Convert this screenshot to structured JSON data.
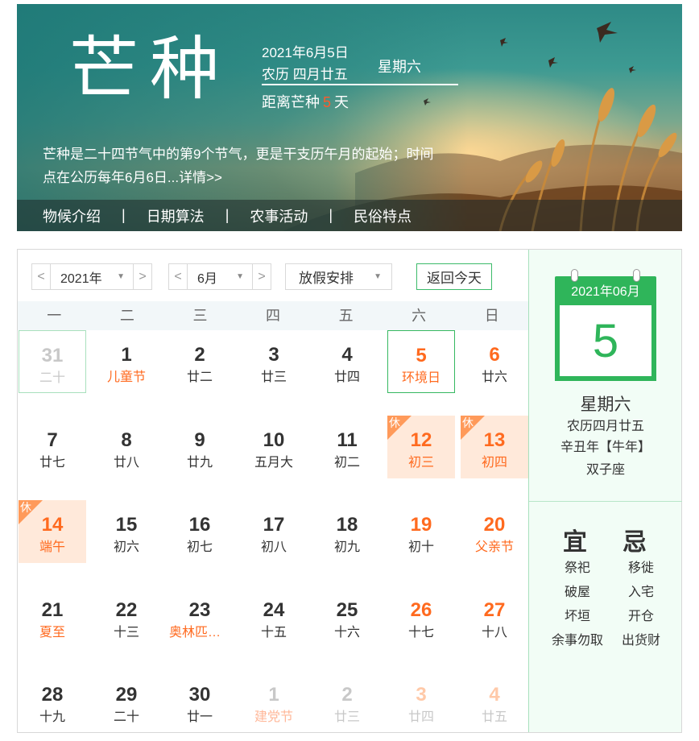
{
  "banner": {
    "term_name": "芒种",
    "date": "2021年6月5日",
    "lunar": "农历 四月廿五",
    "weekday": "星期六",
    "countdown_prefix": "距离芒种",
    "countdown_days": "5",
    "countdown_suffix": "天",
    "description": "芒种是二十四节气中的第9个节气，更是干支历午月的起始；时间点在公历每年6月6日...",
    "more_link": "详情>>",
    "nav": [
      "物候介绍",
      "日期算法",
      "农事活动",
      "民俗特点"
    ],
    "nav_separator": "|"
  },
  "toolbar": {
    "prev_arrow": "<",
    "next_arrow": ">",
    "year": "2021年",
    "month": "6月",
    "holiday": "放假安排",
    "today_button": "返回今天",
    "caret": "▼"
  },
  "weekdays": [
    "一",
    "二",
    "三",
    "四",
    "五",
    "六",
    "日"
  ],
  "rest_badge": "休",
  "days": [
    {
      "n": "31",
      "s": "二十",
      "other": true,
      "box": "first"
    },
    {
      "n": "1",
      "s": "儿童节",
      "fest": true
    },
    {
      "n": "2",
      "s": "廿二"
    },
    {
      "n": "3",
      "s": "廿三"
    },
    {
      "n": "4",
      "s": "廿四"
    },
    {
      "n": "5",
      "s": "环境日",
      "weekend": true,
      "box": "today"
    },
    {
      "n": "6",
      "s": "廿六",
      "weekend": true,
      "sub_plain": true
    },
    {
      "n": "7",
      "s": "廿七"
    },
    {
      "n": "8",
      "s": "廿八"
    },
    {
      "n": "9",
      "s": "廿九"
    },
    {
      "n": "10",
      "s": "五月大"
    },
    {
      "n": "11",
      "s": "初二"
    },
    {
      "n": "12",
      "s": "初三",
      "rest": true
    },
    {
      "n": "13",
      "s": "初四",
      "rest": true
    },
    {
      "n": "14",
      "s": "端午",
      "rest": true
    },
    {
      "n": "15",
      "s": "初六"
    },
    {
      "n": "16",
      "s": "初七"
    },
    {
      "n": "17",
      "s": "初八"
    },
    {
      "n": "18",
      "s": "初九"
    },
    {
      "n": "19",
      "s": "初十",
      "weekend": true,
      "sub_plain": true
    },
    {
      "n": "20",
      "s": "父亲节",
      "weekend": true
    },
    {
      "n": "21",
      "s": "夏至",
      "fest": true
    },
    {
      "n": "22",
      "s": "十三"
    },
    {
      "n": "23",
      "s": "奥林匹克日",
      "fest": true
    },
    {
      "n": "24",
      "s": "十五"
    },
    {
      "n": "25",
      "s": "十六"
    },
    {
      "n": "26",
      "s": "十七",
      "weekend": true,
      "sub_plain": true
    },
    {
      "n": "27",
      "s": "十八",
      "weekend": true,
      "sub_plain": true
    },
    {
      "n": "28",
      "s": "十九"
    },
    {
      "n": "29",
      "s": "二十"
    },
    {
      "n": "30",
      "s": "廿一"
    },
    {
      "n": "1",
      "s": "建党节",
      "other": true,
      "fest": true
    },
    {
      "n": "2",
      "s": "廿三",
      "other": true
    },
    {
      "n": "3",
      "s": "廿四",
      "other": true,
      "weekend": true,
      "sub_plain": true
    },
    {
      "n": "4",
      "s": "廿五",
      "other": true,
      "weekend": true,
      "sub_plain": true
    }
  ],
  "side": {
    "calendar_header": "2021年06月",
    "day": "5",
    "weekday": "星期六",
    "lunar": "农历四月廿五",
    "ganzhi": "辛丑年【牛年】",
    "constellation": "双子座",
    "yi_title": "宜",
    "ji_title": "忌",
    "yi": [
      "祭祀",
      "破屋",
      "坏垣",
      "余事勿取"
    ],
    "ji": [
      "移徙",
      "入宅",
      "开仓",
      "出货财"
    ]
  },
  "colors": {
    "accent_green": "#2fb55a",
    "holiday_orange": "#ff6a1f",
    "rest_bg": "#ffe9da"
  }
}
